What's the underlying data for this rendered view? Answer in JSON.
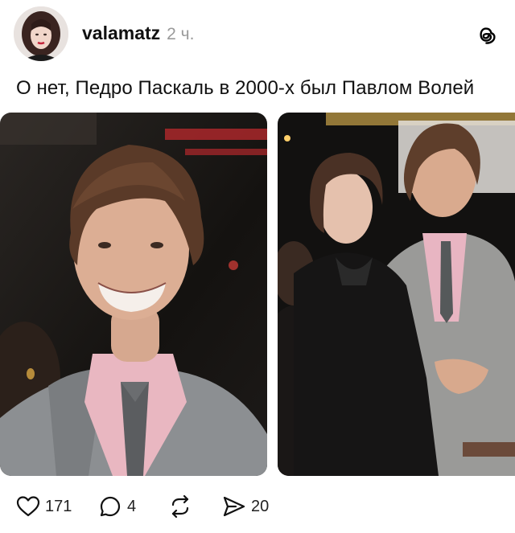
{
  "post": {
    "username": "valamatz",
    "time": "2 ч.",
    "caption": "О нет, Педро Паскаль в 2000-х был Павлом Волей"
  },
  "actions": {
    "likes": "171",
    "comments": "4",
    "shares": "20"
  },
  "icons": {
    "like": "heart-icon",
    "comment": "comment-bubble-icon",
    "repost": "repost-icon",
    "share": "send-icon",
    "app": "threads-logo-icon"
  }
}
